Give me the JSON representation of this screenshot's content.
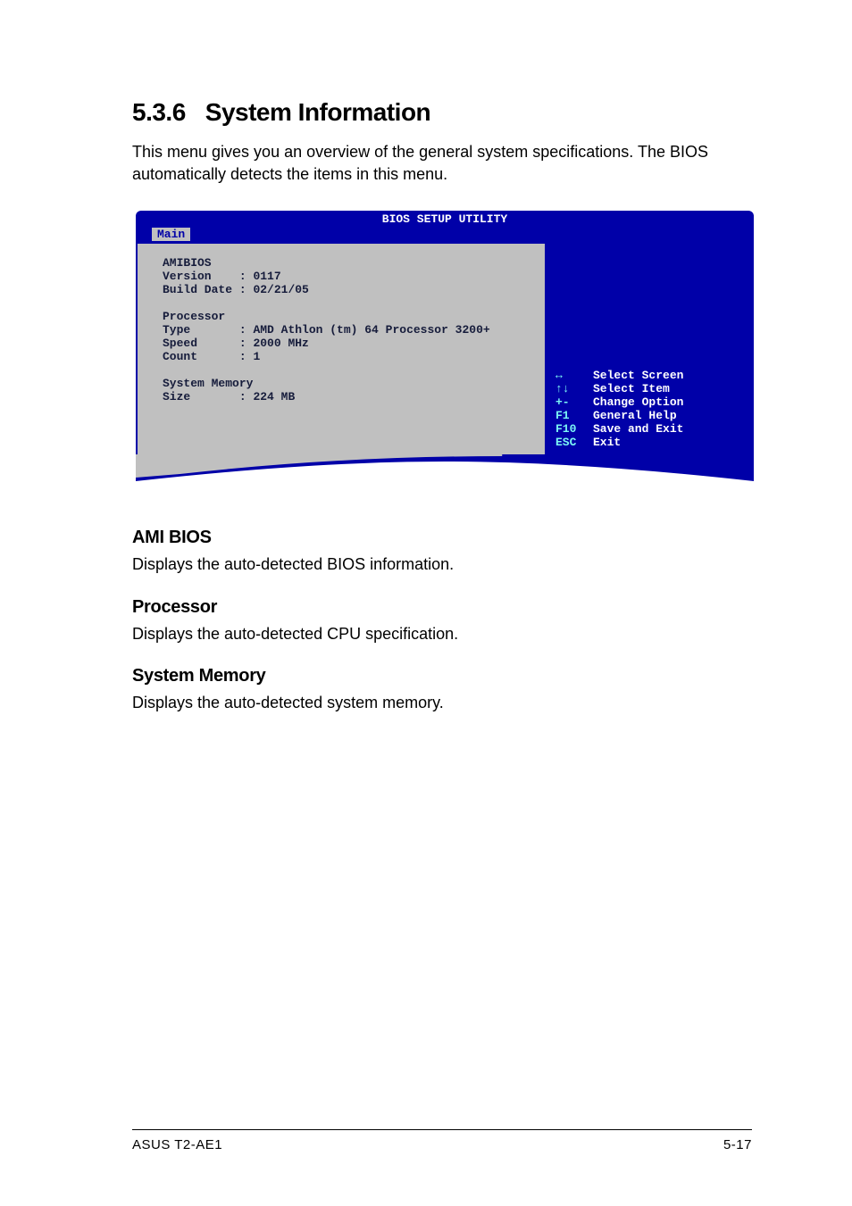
{
  "section": {
    "number": "5.3.6",
    "title": "System Information"
  },
  "intro": "This menu gives you an overview of the general system specifications. The BIOS automatically detects the items in this menu.",
  "bios": {
    "header": "BIOS SETUP UTILITY",
    "tab": "Main",
    "rows": {
      "amibios_hdr": "AMIBIOS",
      "version_label": "Version    :",
      "version_value": "0117",
      "build_label": "Build Date :",
      "build_value": "02/21/05",
      "proc_hdr": "Processor",
      "type_label": "Type       :",
      "type_value": "AMD Athlon (tm) 64 Processor 3200+",
      "speed_label": "Speed      :",
      "speed_value": "2000 MHz",
      "count_label": "Count      :",
      "count_value": "1",
      "mem_hdr": "System Memory",
      "size_label": "Size       :",
      "size_value": "224 MB"
    },
    "nav": [
      {
        "key": "↔",
        "label": "Select Screen"
      },
      {
        "key": "↑↓",
        "label": "Select Item"
      },
      {
        "key": "+-",
        "label": "Change Option"
      },
      {
        "key": "F1",
        "label": "General Help"
      },
      {
        "key": "F10",
        "label": "Save and Exit"
      },
      {
        "key": "ESC",
        "label": "Exit"
      }
    ]
  },
  "subsections": {
    "ami": {
      "title": "AMI BIOS",
      "text": "Displays the auto-detected BIOS information."
    },
    "proc": {
      "title": "Processor",
      "text": "Displays the auto-detected CPU specification."
    },
    "mem": {
      "title": "System Memory",
      "text": "Displays the auto-detected system memory."
    }
  },
  "footer": {
    "left": "ASUS T2-AE1",
    "right": "5-17"
  }
}
